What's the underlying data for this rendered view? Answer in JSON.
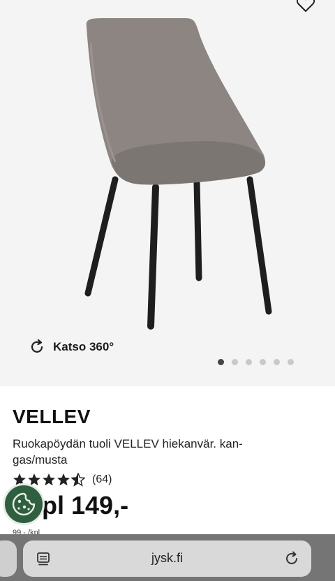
{
  "gallery": {
    "view360_label": "Katso 360°",
    "dots": [
      true,
      false,
      false,
      false,
      false,
      false
    ]
  },
  "product": {
    "name": "VELLEV",
    "description": "Ruokapöydän tuoli VELLEV hiekanvär. kan-gas/musta",
    "rating": 4.5,
    "review_count": "(64)",
    "price": "kpl 149,-",
    "unit_price": "99,- /kpl"
  },
  "browser": {
    "url": "jysk.fi"
  },
  "colors": {
    "gallery_bg": "#f4f4f4",
    "cookie_badge": "#2f5f3e",
    "browser_bar": "#757575"
  },
  "icons": [
    "heart-icon",
    "rotate-360-icon",
    "star-icon",
    "cookie-icon",
    "tabs-icon",
    "reload-icon"
  ]
}
